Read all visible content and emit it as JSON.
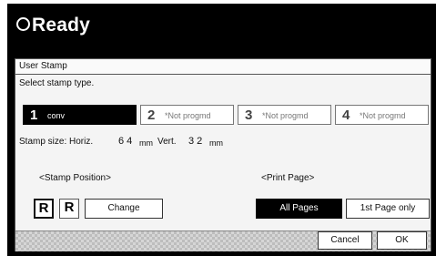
{
  "status": {
    "text": "Ready"
  },
  "dialog": {
    "heading": "User Stamp",
    "instruction": "Select stamp type.",
    "stamps": [
      {
        "number": "1",
        "label": "conv"
      },
      {
        "number": "2",
        "label": "*Not progmd"
      },
      {
        "number": "3",
        "label": "*Not progmd"
      },
      {
        "number": "4",
        "label": "*Not progmd"
      }
    ],
    "selected_stamp": "1",
    "size_label": "Stamp size: Horiz.",
    "horiz_value": "6 4",
    "horiz_unit": "mm",
    "vert_label": "Vert.",
    "vert_value": "3 2",
    "vert_unit": "mm",
    "stamp_position_label": "<Stamp Position>",
    "change_label": "Change",
    "position_icon_glyph": "R",
    "print_page_label": "<Print Page>",
    "print_page_options": [
      "All Pages",
      "1st Page only"
    ],
    "selected_print_page": "All Pages",
    "cancel_label": "Cancel",
    "ok_label": "OK"
  }
}
